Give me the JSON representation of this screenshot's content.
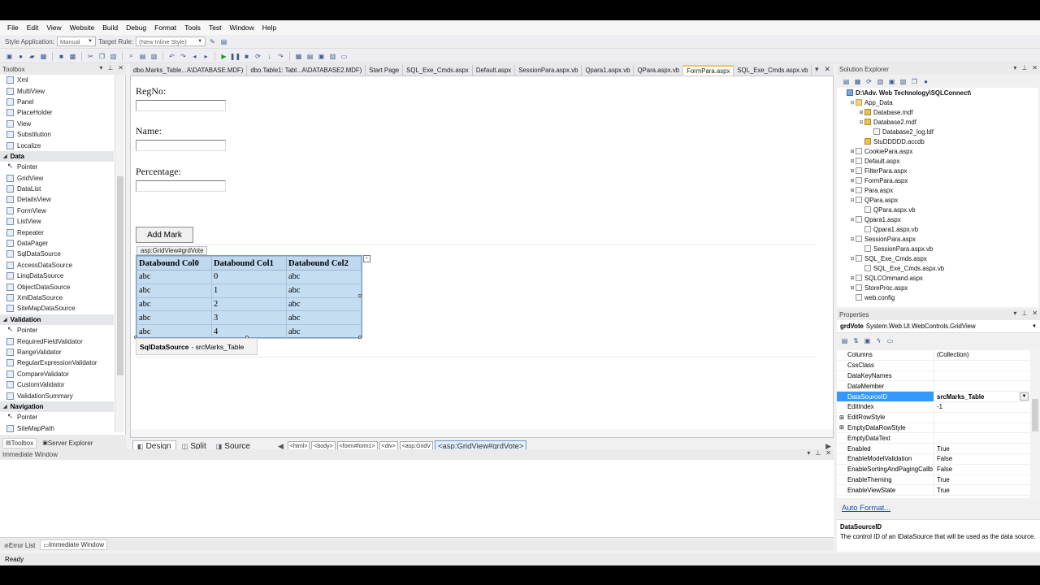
{
  "menu": [
    "File",
    "Edit",
    "View",
    "Website",
    "Build",
    "Debug",
    "Format",
    "Tools",
    "Test",
    "Window",
    "Help"
  ],
  "style_toolbar": {
    "style_app_label": "Style Application:",
    "style_app_value": "Manual",
    "target_rule_label": "Target Rule:",
    "target_rule_value": "(New Inline Style)"
  },
  "toolbox": {
    "title": "Toolbox",
    "groups": [
      {
        "type": "item",
        "label": "Xml"
      },
      {
        "type": "item",
        "label": "MultiView"
      },
      {
        "type": "item",
        "label": "Panel"
      },
      {
        "type": "item",
        "label": "PlaceHolder"
      },
      {
        "type": "item",
        "label": "View"
      },
      {
        "type": "item",
        "label": "Substitution"
      },
      {
        "type": "item",
        "label": "Localize"
      },
      {
        "type": "group",
        "label": "Data"
      },
      {
        "type": "item",
        "label": "Pointer"
      },
      {
        "type": "item",
        "label": "GridView"
      },
      {
        "type": "item",
        "label": "DataList"
      },
      {
        "type": "item",
        "label": "DetailsView"
      },
      {
        "type": "item",
        "label": "FormView"
      },
      {
        "type": "item",
        "label": "ListView"
      },
      {
        "type": "item",
        "label": "Repeater"
      },
      {
        "type": "item",
        "label": "DataPager"
      },
      {
        "type": "item",
        "label": "SqlDataSource"
      },
      {
        "type": "item",
        "label": "AccessDataSource"
      },
      {
        "type": "item",
        "label": "LinqDataSource"
      },
      {
        "type": "item",
        "label": "ObjectDataSource"
      },
      {
        "type": "item",
        "label": "XmlDataSource"
      },
      {
        "type": "item",
        "label": "SiteMapDataSource"
      },
      {
        "type": "group",
        "label": "Validation"
      },
      {
        "type": "item",
        "label": "Pointer"
      },
      {
        "type": "item",
        "label": "RequiredFieldValidator"
      },
      {
        "type": "item",
        "label": "RangeValidator"
      },
      {
        "type": "item",
        "label": "RegularExpressionValidator"
      },
      {
        "type": "item",
        "label": "CompareValidator"
      },
      {
        "type": "item",
        "label": "CustomValidator"
      },
      {
        "type": "item",
        "label": "ValidationSummary"
      },
      {
        "type": "group",
        "label": "Navigation"
      },
      {
        "type": "item",
        "label": "Pointer"
      },
      {
        "type": "item",
        "label": "SiteMapPath"
      }
    ],
    "tabs": [
      "Toolbox",
      "Server Explorer"
    ]
  },
  "doc_tabs": [
    {
      "label": "dbo.Marks_Table...A\\DATABASE.MDF)",
      "active": false
    },
    {
      "label": "dbo.Table1: Tabl...A\\DATABASE2.MDF)",
      "active": false
    },
    {
      "label": "Start Page",
      "active": false
    },
    {
      "label": "SQL_Exe_Cmds.aspx",
      "active": false
    },
    {
      "label": "Default.aspx",
      "active": false
    },
    {
      "label": "SessionPara.aspx.vb",
      "active": false
    },
    {
      "label": "Qpara1.aspx.vb",
      "active": false
    },
    {
      "label": "QPara.aspx.vb",
      "active": false
    },
    {
      "label": "FormPara.aspx",
      "active": true
    },
    {
      "label": "SQL_Exe_Cmds.aspx.vb",
      "active": false
    }
  ],
  "form": {
    "regno_label": "RegNo:",
    "name_label": "Name:",
    "percentage_label": "Percentage:",
    "add_mark_button": "Add Mark",
    "grid_tag": "asp:GridView#grdVote",
    "grid_headers": [
      "Databound Col0",
      "Databound Col1",
      "Databound Col2"
    ],
    "grid_rows": [
      [
        "abc",
        "0",
        "abc"
      ],
      [
        "abc",
        "1",
        "abc"
      ],
      [
        "abc",
        "2",
        "abc"
      ],
      [
        "abc",
        "3",
        "abc"
      ],
      [
        "abc",
        "4",
        "abc"
      ]
    ],
    "sqlds_bold": "SqlDataSource",
    "sqlds_rest": "- srcMarks_Table"
  },
  "view_bar": {
    "design": "Design",
    "split": "Split",
    "source": "Source",
    "crumbs": [
      "<html>",
      "<body>",
      "<form#form1>",
      "<div>",
      "<asp:GridV"
    ],
    "active_crumb": "<asp:GridView#grdVote>"
  },
  "immediate": {
    "title": "Immediate Window",
    "tabs": [
      "Error List",
      "Immediate Window"
    ]
  },
  "solution_explorer": {
    "title": "Solution Explorer",
    "tree": [
      {
        "label": "D:\\Adv. Web Technology\\SQLConnect\\",
        "level": 0,
        "exp": "",
        "icon": "root",
        "bold": true
      },
      {
        "label": "App_Data",
        "level": 1,
        "exp": "−",
        "icon": "folder"
      },
      {
        "label": "Database.mdf",
        "level": 2,
        "exp": "+",
        "icon": "db"
      },
      {
        "label": "Database2.mdf",
        "level": 2,
        "exp": "−",
        "icon": "db"
      },
      {
        "label": "Database2_log.ldf",
        "level": 3,
        "exp": "",
        "icon": "file"
      },
      {
        "label": "StuDDDDD.accdb",
        "level": 2,
        "exp": "",
        "icon": "db"
      },
      {
        "label": "CookiePara.aspx",
        "level": 1,
        "exp": "+",
        "icon": "file"
      },
      {
        "label": "Default.aspx",
        "level": 1,
        "exp": "+",
        "icon": "file"
      },
      {
        "label": "FilterPara.aspx",
        "level": 1,
        "exp": "+",
        "icon": "file"
      },
      {
        "label": "FormPara.aspx",
        "level": 1,
        "exp": "+",
        "icon": "file"
      },
      {
        "label": "Para.aspx",
        "level": 1,
        "exp": "+",
        "icon": "file"
      },
      {
        "label": "QPara.aspx",
        "level": 1,
        "exp": "−",
        "icon": "file"
      },
      {
        "label": "QPara.aspx.vb",
        "level": 2,
        "exp": "",
        "icon": "file"
      },
      {
        "label": "Qpara1.aspx",
        "level": 1,
        "exp": "−",
        "icon": "file"
      },
      {
        "label": "Qpara1.aspx.vb",
        "level": 2,
        "exp": "",
        "icon": "file"
      },
      {
        "label": "SessionPara.aspx",
        "level": 1,
        "exp": "−",
        "icon": "file"
      },
      {
        "label": "SessionPara.aspx.vb",
        "level": 2,
        "exp": "",
        "icon": "file"
      },
      {
        "label": "SQL_Exe_Cmds.aspx",
        "level": 1,
        "exp": "−",
        "icon": "file"
      },
      {
        "label": "SQL_Exe_Cmds.aspx.vb",
        "level": 2,
        "exp": "",
        "icon": "file"
      },
      {
        "label": "SQLCOmmand.aspx",
        "level": 1,
        "exp": "+",
        "icon": "file"
      },
      {
        "label": "StoreProc.aspx",
        "level": 1,
        "exp": "+",
        "icon": "file"
      },
      {
        "label": "web.config",
        "level": 1,
        "exp": "",
        "icon": "file"
      }
    ]
  },
  "properties": {
    "title": "Properties",
    "object_name": "grdVote",
    "object_type": "System.Web.UI.WebControls.GridView",
    "rows": [
      {
        "name": "Columns",
        "value": "(Collection)",
        "plus": false
      },
      {
        "name": "CssClass",
        "value": "",
        "plus": false
      },
      {
        "name": "DataKeyNames",
        "value": "",
        "plus": false
      },
      {
        "name": "DataMember",
        "value": "",
        "plus": false
      },
      {
        "name": "DataSourceID",
        "value": "srcMarks_Table",
        "plus": false,
        "selected": true
      },
      {
        "name": "EditIndex",
        "value": "-1",
        "plus": false
      },
      {
        "name": "EditRowStyle",
        "value": "",
        "plus": true
      },
      {
        "name": "EmptyDataRowStyle",
        "value": "",
        "plus": true
      },
      {
        "name": "EmptyDataText",
        "value": "",
        "plus": false
      },
      {
        "name": "Enabled",
        "value": "True",
        "plus": false
      },
      {
        "name": "EnableModelValidation",
        "value": "False",
        "plus": false
      },
      {
        "name": "EnableSortingAndPagingCallb",
        "value": "False",
        "plus": false
      },
      {
        "name": "EnableTheming",
        "value": "True",
        "plus": false
      },
      {
        "name": "EnableViewState",
        "value": "True",
        "plus": false
      }
    ],
    "auto_format": "Auto Format...",
    "desc_name": "DataSourceID",
    "desc_text": "The control ID of an IDataSource that will be used as the data source."
  },
  "status": "Ready"
}
